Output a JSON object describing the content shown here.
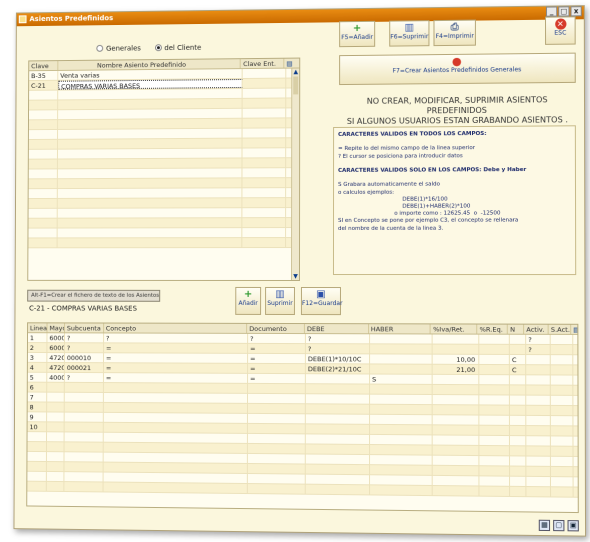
{
  "window": {
    "title": "Asientos Predefinidos",
    "controls": [
      "_",
      "□",
      "x"
    ]
  },
  "filter": {
    "options": [
      {
        "label": "Generales",
        "selected": false
      },
      {
        "label": "del Cliente",
        "selected": true
      }
    ]
  },
  "top_grid": {
    "columns": [
      "Clave",
      "Nombre Asiento Predefinido",
      "Clave Ent."
    ],
    "rows": [
      {
        "clave": "B-35",
        "nombre": "Venta varias",
        "clave_ent": ""
      },
      {
        "clave": "C-21",
        "nombre": "COMPRAS VARIAS BASES",
        "clave_ent": ""
      }
    ],
    "total_rows": 18
  },
  "toolbar": {
    "add": "F5=Añadir",
    "delete": "F6=Suprimir",
    "print": "F4=Imprimir",
    "exit": "ESC",
    "create_general": "F7=Crear Asientos Predefinidos Generales"
  },
  "warning": {
    "line1": "NO CREAR, MODIFICAR, SUPRIMIR ASIENTOS PREDEFINIDOS",
    "line2": "SI ALGUNOS USUARIOS ESTAN GRABANDO ASIENTOS ."
  },
  "info": {
    "h1": "CARACTERES VALIDOS EN TODOS LOS CAMPOS:",
    "l1": "= Repite lo del mismo campo de la linea superior",
    "l2": "? El cursor se posiciona para introducir datos",
    "h2": "CARACTERES VALIDOS SOLO EN LOS CAMPOS: Debe y Haber",
    "l3": "S Grabara automaticamente el saldo",
    "l4": "o calculos ejemplos:",
    "l5": "DEBE(1)*16/100",
    "l6": "DEBE(1)+HABER(2)*100",
    "l7": "o importe como : 12625.45  o  -12500",
    "l8": "SI en Concepto se pone por ejemplo C3, el concepto se rellenara",
    "l9": "del nombre de la cuenta de la linea 3."
  },
  "file_button": "Alt-F1=Crear el fichero de texto de los Asientos",
  "current_entry": "C-21 - COMPRAS VARIAS BASES",
  "mid_toolbar": {
    "add": "Añadir",
    "delete": "Suprimir",
    "save": "F12=Guardar"
  },
  "bottom_grid": {
    "columns": [
      "Linea",
      "Mayor",
      "Subcuenta",
      "Concepto",
      "Documento",
      "DEBE",
      "HABER",
      "%Iva/Ret.",
      "%R.Eq.",
      "N",
      "Activ.",
      "S.Act."
    ],
    "rows": [
      {
        "linea": "1",
        "mayor": "6000",
        "sub": "?",
        "concepto": "?",
        "doc": "?",
        "debe": "?",
        "haber": "",
        "iva": "",
        "req": "",
        "n": "",
        "activ": "?",
        "sact": ""
      },
      {
        "linea": "2",
        "mayor": "6000",
        "sub": "?",
        "concepto": "=",
        "doc": "=",
        "debe": "?",
        "haber": "",
        "iva": "",
        "req": "",
        "n": "",
        "activ": "?",
        "sact": ""
      },
      {
        "linea": "3",
        "mayor": "4720",
        "sub": "000010",
        "concepto": "=",
        "doc": "=",
        "debe": "DEBE(1)*10/10C",
        "haber": "",
        "iva": "10,00",
        "req": "",
        "n": "C",
        "activ": "",
        "sact": ""
      },
      {
        "linea": "4",
        "mayor": "4720",
        "sub": "000021",
        "concepto": "=",
        "doc": "=",
        "debe": "DEBE(2)*21/10C",
        "haber": "",
        "iva": "21,00",
        "req": "",
        "n": "C",
        "activ": "",
        "sact": ""
      },
      {
        "linea": "5",
        "mayor": "4000",
        "sub": "?",
        "concepto": "=",
        "doc": "=",
        "debe": "",
        "haber": "S",
        "iva": "",
        "req": "",
        "n": "",
        "activ": "",
        "sact": ""
      },
      {
        "linea": "6",
        "mayor": "",
        "sub": "",
        "concepto": "",
        "doc": "",
        "debe": "",
        "haber": "",
        "iva": "",
        "req": "",
        "n": "",
        "activ": "",
        "sact": ""
      },
      {
        "linea": "7",
        "mayor": "",
        "sub": "",
        "concepto": "",
        "doc": "",
        "debe": "",
        "haber": "",
        "iva": "",
        "req": "",
        "n": "",
        "activ": "",
        "sact": ""
      },
      {
        "linea": "8",
        "mayor": "",
        "sub": "",
        "concepto": "",
        "doc": "",
        "debe": "",
        "haber": "",
        "iva": "",
        "req": "",
        "n": "",
        "activ": "",
        "sact": ""
      },
      {
        "linea": "9",
        "mayor": "",
        "sub": "",
        "concepto": "",
        "doc": "",
        "debe": "",
        "haber": "",
        "iva": "",
        "req": "",
        "n": "",
        "activ": "",
        "sact": ""
      },
      {
        "linea": "10",
        "mayor": "",
        "sub": "",
        "concepto": "",
        "doc": "",
        "debe": "",
        "haber": "",
        "iva": "",
        "req": "",
        "n": "",
        "activ": "",
        "sact": ""
      }
    ],
    "total_rows": 16
  },
  "icons": {
    "add": "plus-icon",
    "delete": "trash-icon",
    "print": "printer-icon",
    "exit": "close-icon",
    "save": "floppy-icon"
  },
  "colors": {
    "title_bar": "#e07f0c",
    "panel_bg": "#fbf7dd",
    "accent_blue": "#1a3b8a",
    "exit_red": "#d63a2a"
  }
}
